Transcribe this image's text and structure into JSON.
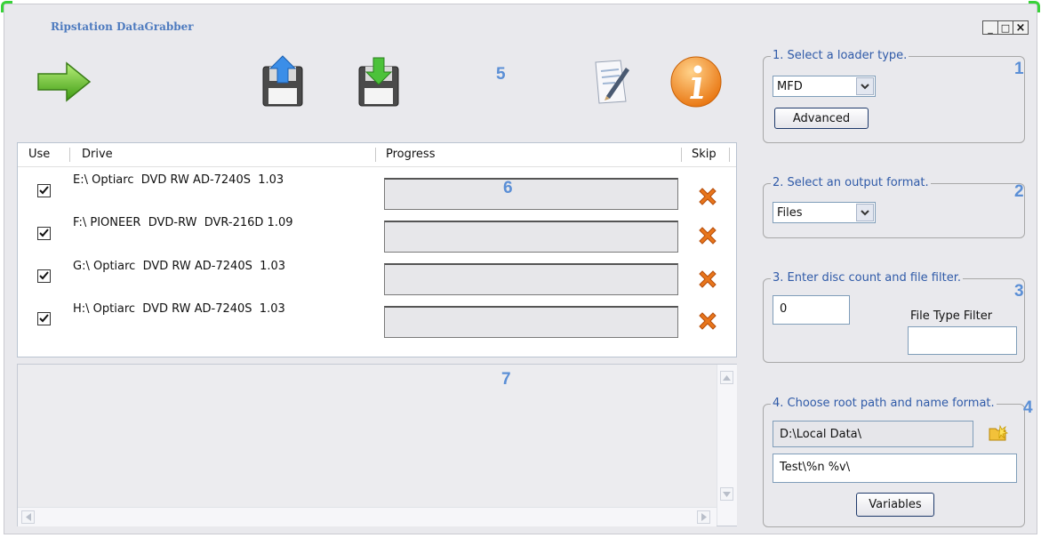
{
  "window": {
    "title": "Ripstation DataGrabber",
    "controls": {
      "minimize": "_",
      "maximize": "□",
      "close": "×"
    }
  },
  "toolbar": {
    "callout": "5",
    "icons": [
      "start-arrow-icon",
      "upload-floppy-icon",
      "download-floppy-icon",
      "document-edit-icon",
      "info-icon"
    ]
  },
  "drives_table": {
    "callout": "6",
    "headers": {
      "use": "Use",
      "drive": "Drive",
      "progress": "Progress",
      "skip": "Skip"
    },
    "rows": [
      {
        "checked": true,
        "drive": "E:\\ Optiarc  DVD RW AD-7240S  1.03",
        "progress": 0
      },
      {
        "checked": true,
        "drive": "F:\\ PIONEER  DVD-RW  DVR-216D 1.09",
        "progress": 0
      },
      {
        "checked": true,
        "drive": "G:\\ Optiarc  DVD RW AD-7240S  1.03",
        "progress": 0
      },
      {
        "checked": true,
        "drive": "H:\\ Optiarc  DVD RW AD-7240S  1.03",
        "progress": 0
      }
    ]
  },
  "log": {
    "callout": "7"
  },
  "settings": {
    "loader": {
      "label": "1. Select a loader type.",
      "callout": "1",
      "selected": "MFD",
      "advanced_label": "Advanced"
    },
    "output": {
      "label": "2. Select an output format.",
      "callout": "2",
      "selected": "Files"
    },
    "disc": {
      "label": "3. Enter disc count and file filter.",
      "callout": "3",
      "count": "0",
      "filter_label": "File Type Filter",
      "filter_value": ""
    },
    "path": {
      "label": "4. Choose root path and name format.",
      "callout": "4",
      "root_path": "D:\\Local Data\\",
      "name_format": "Test\\%n %v\\",
      "variables_label": "Variables"
    }
  },
  "colors": {
    "accent": "#5b8fd6",
    "group_label": "#2f5aa8",
    "skip_x": "#e8761c",
    "window_bg": "#e9e9ed"
  }
}
